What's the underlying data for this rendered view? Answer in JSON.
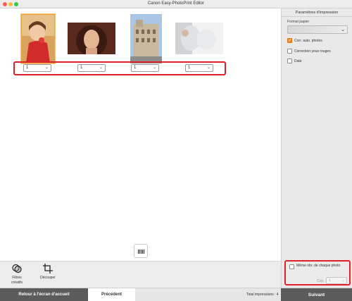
{
  "window": {
    "title": "Canon Easy-PhotoPrint Editor"
  },
  "thumbnails": [
    {
      "description_icon": "photo-child-icon",
      "copies": "1"
    },
    {
      "description_icon": "photo-woman-icon",
      "copies": "1"
    },
    {
      "description_icon": "photo-building-icon",
      "copies": "1"
    },
    {
      "description_icon": "photo-baby-icon",
      "copies": "1"
    }
  ],
  "tools": {
    "filters_label": "Filtres créatifs",
    "crop_label": "Découper"
  },
  "sidebar": {
    "title": "Paramètres d'impression",
    "paper_label": "Format papier",
    "options": [
      {
        "label": "Corr. auto. photos",
        "checked": true
      },
      {
        "label": "Correction yeux rouges",
        "checked": false
      },
      {
        "label": "Date",
        "checked": false
      }
    ],
    "same_copies_label": "Même nbr. de chaque photo",
    "copies_label": "Cop. :",
    "copies_value": "1"
  },
  "bottom": {
    "home_label": "Retour à l'écran d'accueil",
    "prev_label": "Précédent",
    "total_label": "Total impressions : 4",
    "next_label": "Suivant"
  },
  "colors": {
    "accent_orange": "#f08a24",
    "highlight_red": "#e2202c",
    "dark_button": "#5b5b5b"
  }
}
